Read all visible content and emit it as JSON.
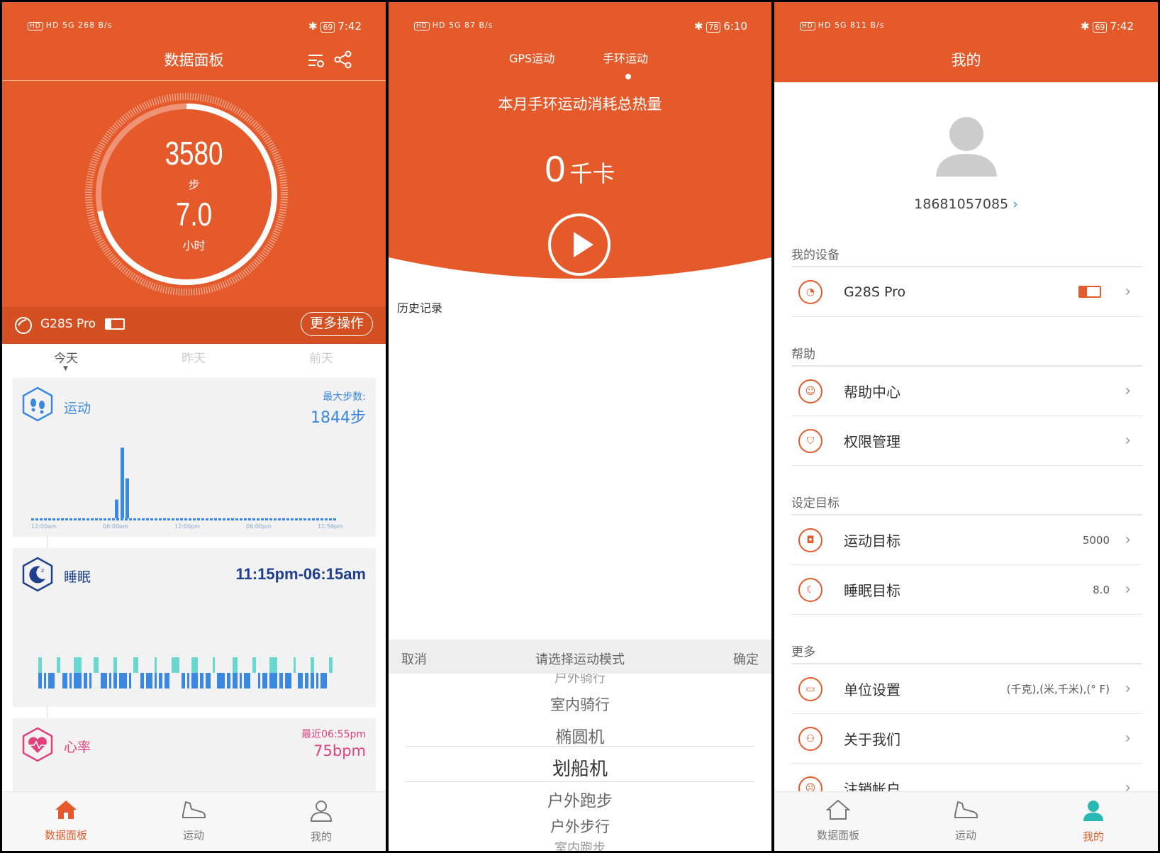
{
  "panel1": {
    "status": {
      "left": "HD 5G 268 B/s",
      "battery": "69",
      "time": "7:42"
    },
    "title": "数据面板",
    "ring": {
      "steps": "3580",
      "steps_unit": "步",
      "hours": "7.0",
      "hours_unit": "小时"
    },
    "device": {
      "name": "G28S Pro",
      "more_label": "更多操作"
    },
    "day_tabs": [
      "今天",
      "昨天",
      "前天"
    ],
    "activity": {
      "title": "运动",
      "max_label": "最大步数:",
      "max_value": "1844步",
      "axis_labels": [
        "12:00am",
        "06:00am",
        "12:00pm",
        "06:00pm",
        "11:59pm"
      ]
    },
    "sleep": {
      "title": "睡眠",
      "range": "11:15pm-06:15am"
    },
    "heart": {
      "title": "心率",
      "latest": "最近06:55pm",
      "value": "75bpm"
    },
    "nav": [
      "数据面板",
      "运动",
      "我的"
    ]
  },
  "panel2": {
    "status": {
      "left": "HD 5G 87 B/s",
      "battery": "78",
      "time": "6:10"
    },
    "tabs": [
      "GPS运动",
      "手环运动"
    ],
    "headline": "本月手环运动消耗总热量",
    "calories": "0",
    "calories_unit": "千卡",
    "history_label": "历史记录",
    "picker": {
      "cancel": "取消",
      "title": "请选择运动模式",
      "confirm": "确定",
      "options": [
        "户外骑行",
        "室内骑行",
        "椭圆机",
        "划船机",
        "户外跑步",
        "户外步行",
        "室内跑步"
      ]
    }
  },
  "panel3": {
    "status": {
      "left": "HD 5G 811 B/s",
      "battery": "69",
      "time": "7:42"
    },
    "title": "我的",
    "phone": "18681057085",
    "sections": {
      "device": "我的设备",
      "help": "帮助",
      "goals": "设定目标",
      "more": "更多"
    },
    "device_name": "G28S Pro",
    "help_center": "帮助中心",
    "permissions": "权限管理",
    "sport_goal": "运动目标",
    "sport_goal_value": "5000",
    "sleep_goal": "睡眠目标",
    "sleep_goal_value": "8.0",
    "units": "单位设置",
    "units_value": "(千克),(米,千米),(° F)",
    "about": "关于我们",
    "logout": "注销帐户",
    "nav": [
      "数据面板",
      "运动",
      "我的"
    ]
  },
  "colors": {
    "accent": "#e55a2b",
    "blue": "#3b88e0",
    "teal": "#2ab9b2",
    "navy": "#1f3f8c",
    "pink": "#e0417a"
  },
  "chart_data": [
    {
      "type": "bar",
      "title": "运动",
      "x": [
        "12:00am",
        "06:00am",
        "12:00pm",
        "06:00pm",
        "11:59pm"
      ],
      "peak_steps": 1844
    },
    {
      "type": "bar",
      "title": "睡眠",
      "range": "11:15pm-06:15am"
    }
  ]
}
